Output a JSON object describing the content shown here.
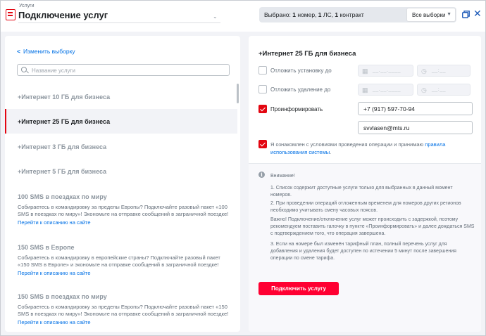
{
  "header": {
    "breadcrumb": "Услуги",
    "title": "Подключение услуг",
    "selection": {
      "prefix": "Выбрано: ",
      "numbers_count": "1",
      "numbers_word": " номер, ",
      "ls_count": "1",
      "ls_word": " ЛС, ",
      "contracts_count": "1",
      "contracts_word": " контракт"
    },
    "all_selections_label": "Все выборки"
  },
  "left": {
    "change_selection_link": "Изменить выборку",
    "search_placeholder": "Название услуги",
    "services": [
      {
        "title": "+Интернет 10 ГБ для бизнеса"
      },
      {
        "title": "+Интернет 25 ГБ для бизнеса"
      },
      {
        "title": "+Интернет 3 ГБ для бизнеса"
      },
      {
        "title": "+Интернет 5 ГБ для бизнеса"
      },
      {
        "title": "100 SMS в поездках по миру",
        "desc": "Собираетесь в командировку за пределы Европы? Подключайте разовый пакет «100 SMS в поездках по миру»! Экономьте на отправке сообщений в заграничной поездке!",
        "link": "Перейти к описанию на сайте"
      },
      {
        "title": "150 SMS в Европе",
        "desc": "Собираетесь в командировку в европейские страны? Подключайте разовый пакет «150 SMS в Европе» и экономьте на отправке сообщений в заграничной поездке!",
        "link": "Перейти к описанию на сайте"
      },
      {
        "title": "150 SMS в поездках по миру",
        "desc": "Собираетесь в командировку за пределы Европы? Подключайте разовый пакет «150 SMS в поездках по миру»! Экономьте на отправке сообщений в заграничной поездке!",
        "link": "Перейти к описанию на сайте"
      }
    ]
  },
  "right": {
    "title": "+Интернет 25 ГБ для бизнеса",
    "postpone_install_label": "Отложить установку до",
    "postpone_delete_label": "Отложить удаление до",
    "date_placeholder": "__.__.____",
    "time_placeholder": "__:__",
    "inform_label": "Проинформировать",
    "phone_value": "+7 (917) 597-70-94",
    "email_value": "svvlasen@mts.ru",
    "agree_text": "Я ознакомлен с условиями проведения операции и принимаю ",
    "agree_link": "правила использования системы",
    "agree_end": ".",
    "notice": {
      "heading": "Внимание!",
      "p1": "1. Список содержит доступные услуги только для выбранных в данный момент номеров.",
      "p2": "2. При проведении операций отложенным временем для номеров других регионов необходимо учитывать смену часовых поясов.",
      "p3": "Важно! Подключение/отключение услуг может происходить с задержкой, поэтому рекомендуем поставить галочку в пункте «Проинформировать» и далее дождаться SMS с подтверждением того, что операция завершена.",
      "p4": "3. Если на номере был изменён тарифный план, полный перечень услуг для добавления и удаления будет доступен по истечении 5 минут после завершения операции по смене тарифа."
    },
    "submit_label": "Подключить услугу"
  },
  "colors": {
    "accent": "#e30611",
    "link": "#0070e5",
    "button": "#ff0032"
  },
  "icons": [
    "app-logo-icon",
    "chevron-down-icon",
    "external-window-icon",
    "close-icon",
    "chevron-left-icon",
    "search-icon",
    "calendar-icon",
    "clock-icon",
    "info-icon"
  ]
}
